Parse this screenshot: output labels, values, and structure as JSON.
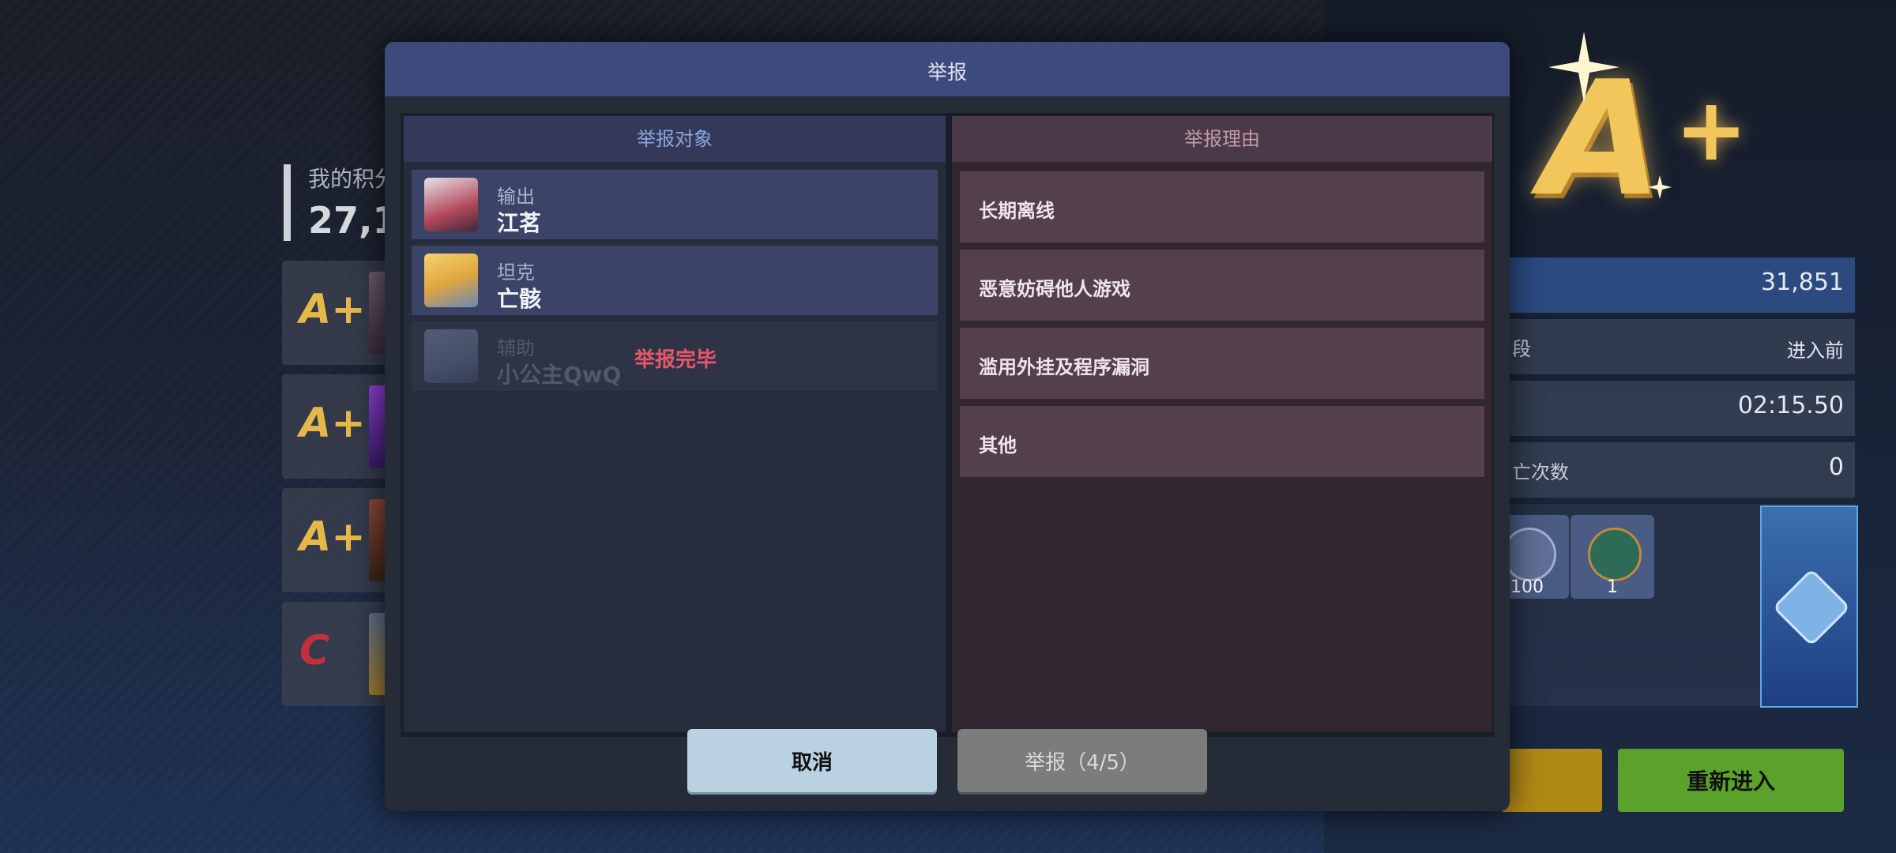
{
  "background": {
    "score_label": "我的积分",
    "score_value": "27,1",
    "ranks": [
      "A+",
      "A+",
      "A+",
      "C"
    ],
    "result": {
      "grade": "A",
      "grade_plus": "+",
      "score": "31,851",
      "row_stage_label": "段",
      "row_stage_value": "进入前",
      "time_value": "02:15.50",
      "death_label": "亡次数",
      "death_value": "0",
      "items": [
        {
          "count": "100",
          "icon": "shield-token-icon"
        },
        {
          "count": "1",
          "icon": "potion-bag-icon"
        }
      ],
      "chest_icon": "chest-icon",
      "reenter_label": "重新进入"
    }
  },
  "modal": {
    "title": "举报",
    "left_header": "举报对象",
    "right_header": "举报理由",
    "targets": [
      {
        "role": "输出",
        "name": "江茗",
        "status": ""
      },
      {
        "role": "坦克",
        "name": "亡骸",
        "status": ""
      },
      {
        "role": "辅助",
        "name": "小公主QwQ",
        "status": "举报完毕"
      }
    ],
    "reasons": [
      "长期离线",
      "恶意妨碍他人游戏",
      "滥用外挂及程序漏洞",
      "其他"
    ],
    "cancel_label": "取消",
    "report_label": "举报（4/5）"
  },
  "colors": {
    "accent_blue": "#3d4a7c",
    "done_red": "#e8566c",
    "grade_gold": "#f3c65c"
  }
}
